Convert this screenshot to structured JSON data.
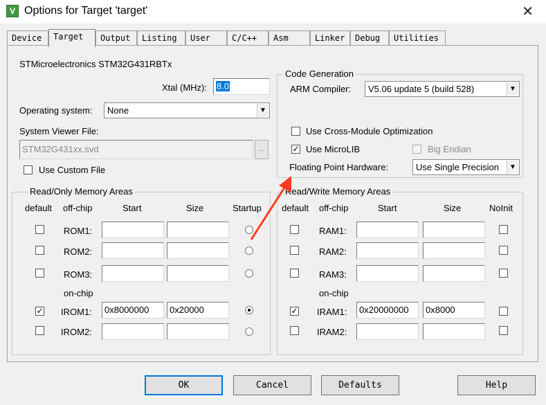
{
  "window": {
    "title": "Options for Target 'target'",
    "close_glyph": "✕"
  },
  "tabs": [
    "Device",
    "Target",
    "Output",
    "Listing",
    "User",
    "C/C++",
    "Asm",
    "Linker",
    "Debug",
    "Utilities"
  ],
  "active_tab": "Target",
  "device_name": "STMicroelectronics STM32G431RBTx",
  "xtal": {
    "label": "Xtal (MHz):",
    "value": "8.0"
  },
  "os": {
    "label": "Operating system:",
    "value": "None"
  },
  "svd": {
    "label": "System Viewer File:",
    "value": "STM32G431xx.svd",
    "browse": "..."
  },
  "custom_file": {
    "label": "Use Custom File",
    "checked": false
  },
  "code_gen": {
    "title": "Code Generation",
    "arm_compiler_label": "ARM Compiler:",
    "arm_compiler_value": "V5.06 update 5 (build 528)",
    "cross_module": {
      "label": "Use Cross-Module Optimization",
      "checked": false
    },
    "microlib": {
      "label": "Use MicroLIB",
      "checked": true
    },
    "big_endian": {
      "label": "Big Endian",
      "checked": false,
      "disabled": true
    },
    "fph_label": "Floating Point Hardware:",
    "fph_value": "Use Single Precision"
  },
  "ro_mem": {
    "title": "Read/Only Memory Areas",
    "headers": {
      "default": "default",
      "offchip": "off-chip",
      "start": "Start",
      "size": "Size",
      "startup": "Startup"
    },
    "onchip_label": "on-chip",
    "rows": [
      {
        "label": "ROM1:",
        "default": false,
        "start": "",
        "size": "",
        "startup": false
      },
      {
        "label": "ROM2:",
        "default": false,
        "start": "",
        "size": "",
        "startup": false
      },
      {
        "label": "ROM3:",
        "default": false,
        "start": "",
        "size": "",
        "startup": false
      },
      {
        "label": "IROM1:",
        "default": true,
        "start": "0x8000000",
        "size": "0x20000",
        "startup": true
      },
      {
        "label": "IROM2:",
        "default": false,
        "start": "",
        "size": "",
        "startup": false
      }
    ]
  },
  "rw_mem": {
    "title": "Read/Write Memory Areas",
    "headers": {
      "default": "default",
      "offchip": "off-chip",
      "start": "Start",
      "size": "Size",
      "noinit": "NoInit"
    },
    "onchip_label": "on-chip",
    "rows": [
      {
        "label": "RAM1:",
        "default": false,
        "start": "",
        "size": "",
        "noinit": false
      },
      {
        "label": "RAM2:",
        "default": false,
        "start": "",
        "size": "",
        "noinit": false
      },
      {
        "label": "RAM3:",
        "default": false,
        "start": "",
        "size": "",
        "noinit": false
      },
      {
        "label": "IRAM1:",
        "default": true,
        "start": "0x20000000",
        "size": "0x8000",
        "noinit": false
      },
      {
        "label": "IRAM2:",
        "default": false,
        "start": "",
        "size": "",
        "noinit": false
      }
    ]
  },
  "buttons": {
    "ok": "OK",
    "cancel": "Cancel",
    "defaults": "Defaults",
    "help": "Help"
  },
  "colors": {
    "arrow": "#ff3b1f",
    "selection": "#0078d7",
    "default_button_border": "#0078d7"
  }
}
